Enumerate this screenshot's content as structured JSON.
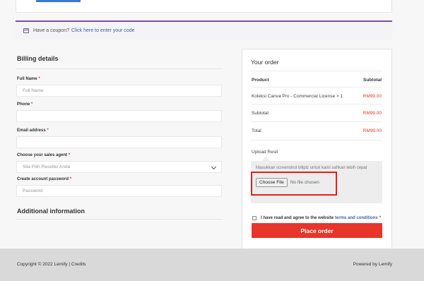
{
  "coupon": {
    "text": "Have a coupon?",
    "link": "Click here to enter your code"
  },
  "billing": {
    "title": "Billing details",
    "full_name": {
      "label": "Full Name",
      "required": "*",
      "placeholder": "Full Name"
    },
    "phone": {
      "label": "Phone",
      "required": "*",
      "placeholder": ""
    },
    "email": {
      "label": "Email address",
      "required": "*",
      "placeholder": ""
    },
    "agent": {
      "label": "Choose your sales agent",
      "required": "*",
      "selected": "Sila Pilih Reseller Anda"
    },
    "password": {
      "label": "Create account password",
      "required": "*",
      "placeholder": "Password"
    }
  },
  "additional": {
    "title": "Additional information"
  },
  "order": {
    "title": "Your order",
    "col_product": "Product",
    "col_subtotal": "Subtotal",
    "item_name": "Koleksi Canva Pro - Commercial License",
    "item_qty": "× 1",
    "item_price": "RM99.00",
    "subtotal_label": "Subtotal",
    "subtotal_value": "RM99.00",
    "total_label": "Total",
    "total_value": "RM99.00",
    "upload_label": "Upload Resit",
    "upload_hint": "Masukkan screenshot billplz untuk kami sahkan lebih cepat",
    "file_button": "Choose File",
    "file_status": "No file chosen",
    "terms_text": "I have read and agree to the website",
    "terms_link": "terms and conditions",
    "terms_req": "*",
    "place_order": "Place order"
  },
  "footer": {
    "copyright": "Copyright © 2022 Lemify | Credits",
    "powered": "Powered by Lemify"
  },
  "colors": {
    "accent_purple": "#7a4fa3",
    "price_red": "#e0392b",
    "button_red": "#e8352b",
    "highlight_red": "#e02020"
  }
}
